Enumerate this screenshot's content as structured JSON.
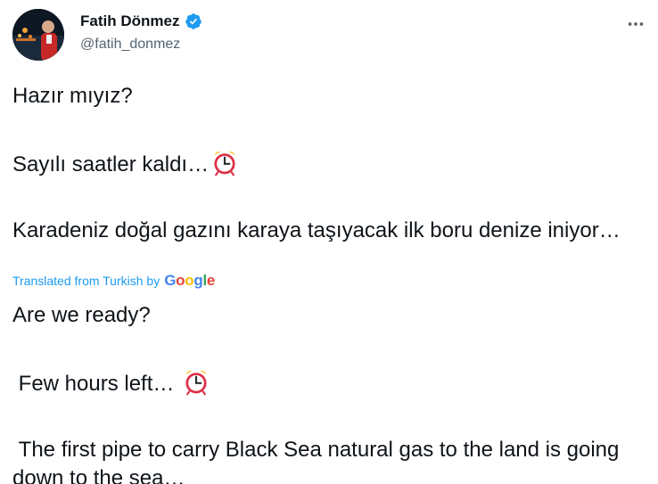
{
  "author": {
    "display_name": "Fatih Dönmez",
    "handle": "@fatih_donmez",
    "verified": true
  },
  "icons": {
    "more": "more-horizontal-icon",
    "verified": "verified-badge-icon",
    "clock": "alarm-clock-emoji"
  },
  "tweet": {
    "line1": "Hazır mıyız?",
    "line2": "Sayılı saatler kaldı…",
    "line3": "Karadeniz doğal gazını karaya taşıyacak ilk boru denize iniyor…"
  },
  "translation_label": {
    "prefix": "Translated from Turkish by",
    "brand": "Google"
  },
  "translation": {
    "line1": "Are we ready?",
    "line2": " Few hours left…",
    "line3": " The first pipe to carry Black Sea natural gas to the land is going down to the sea…"
  },
  "colors": {
    "link": "#1d9bf0",
    "secondary_text": "#536471",
    "primary_text": "#0f1419",
    "verified": "#1d9bf0",
    "clock_red": "#dd2e44"
  }
}
